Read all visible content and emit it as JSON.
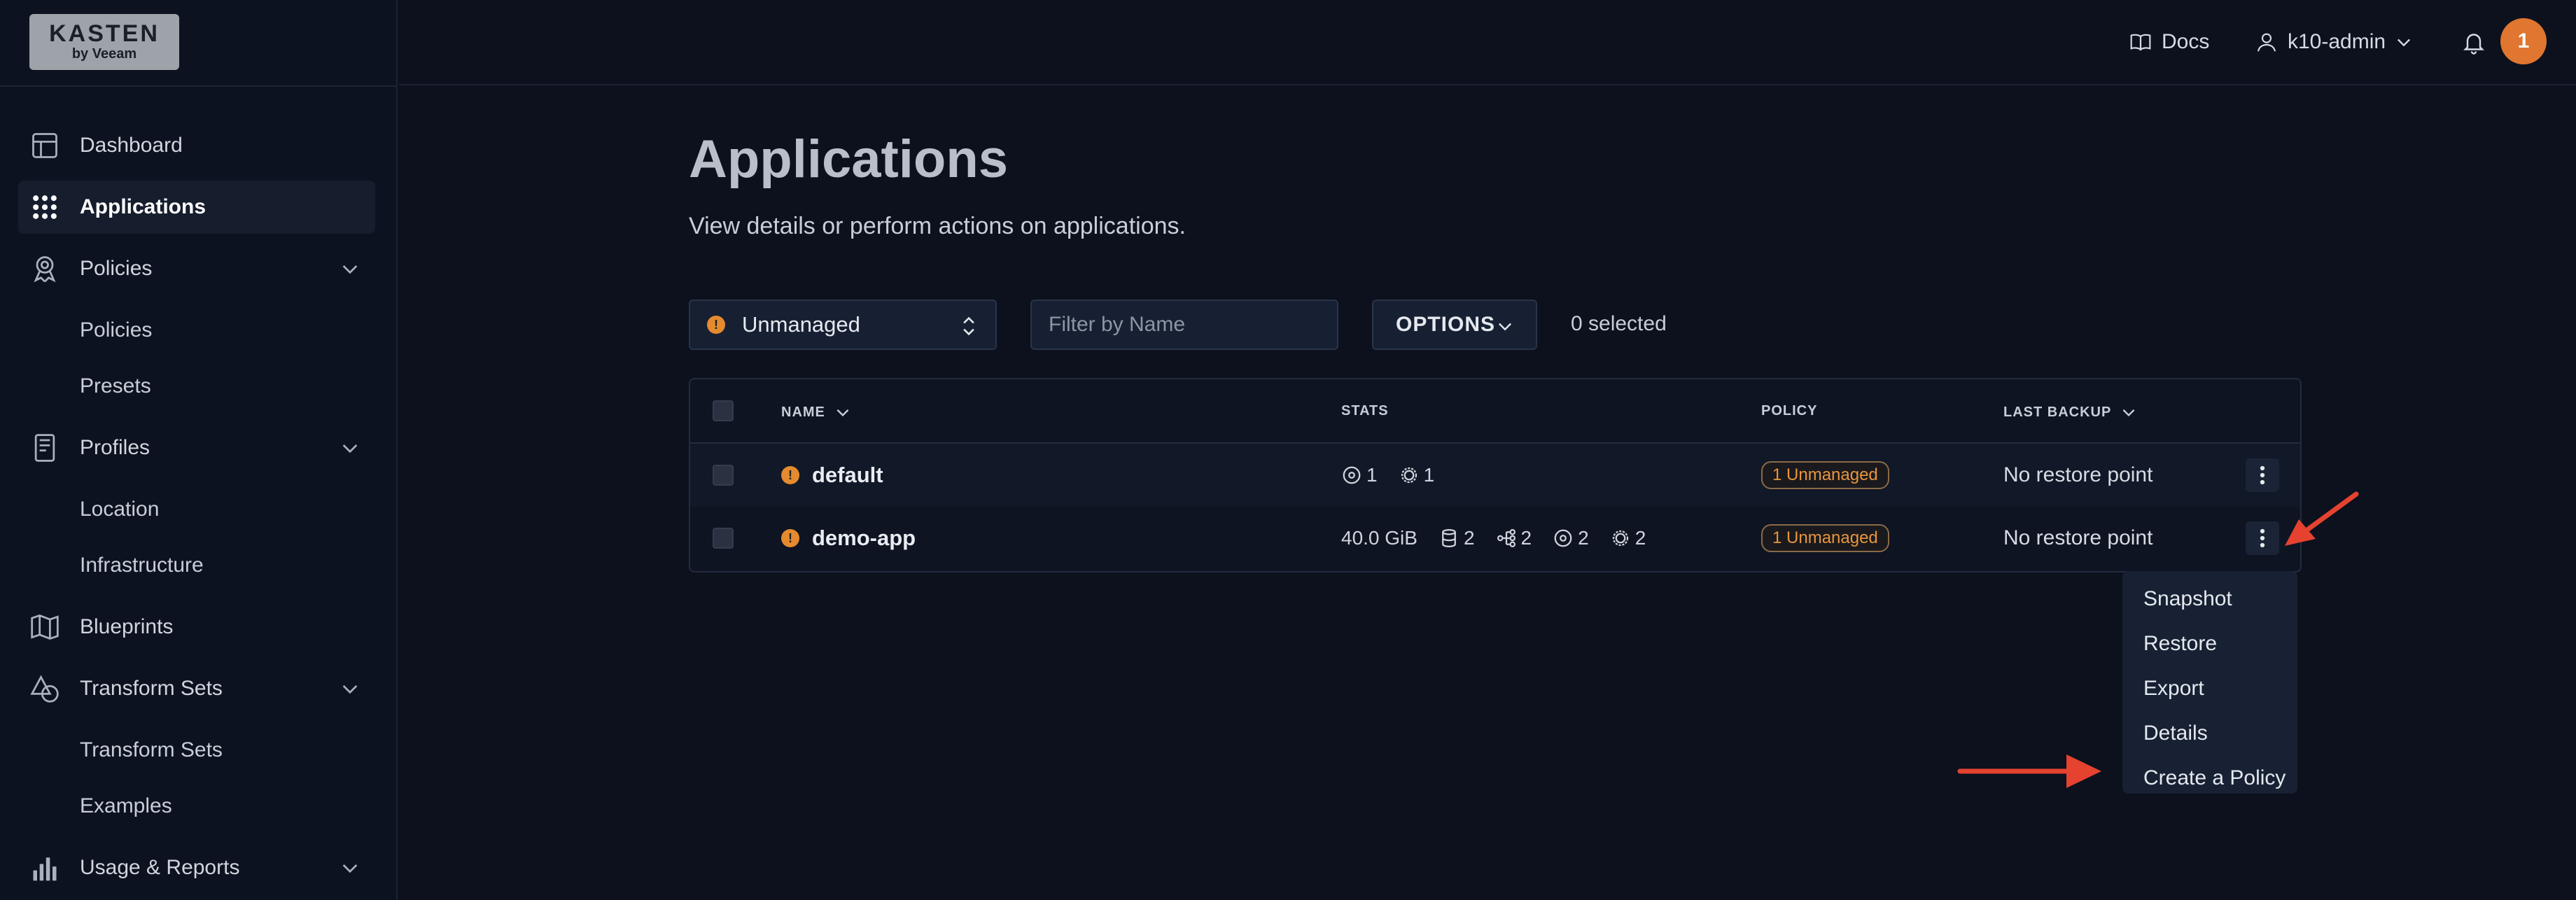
{
  "brand": {
    "line1": "KASTEN",
    "line2": "by Veeam"
  },
  "sidebar": {
    "items": [
      {
        "label": "Dashboard",
        "icon": "dashboard-icon"
      },
      {
        "label": "Applications",
        "icon": "grid-icon",
        "active": true
      },
      {
        "label": "Policies",
        "icon": "rocket-icon",
        "expandable": true
      },
      {
        "label": "Profiles",
        "icon": "document-icon",
        "expandable": true
      },
      {
        "label": "Blueprints",
        "icon": "map-icon"
      },
      {
        "label": "Transform Sets",
        "icon": "shapes-icon",
        "expandable": true
      },
      {
        "label": "Usage & Reports",
        "icon": "bar-chart-icon",
        "expandable": true
      }
    ],
    "sub": {
      "policies": [
        "Policies",
        "Presets"
      ],
      "profiles": [
        "Location",
        "Infrastructure"
      ],
      "transform_sets": [
        "Transform Sets",
        "Examples"
      ]
    }
  },
  "header": {
    "docs": "Docs",
    "user": "k10-admin",
    "notifications": "1"
  },
  "main": {
    "title": "Applications",
    "description": "View details or perform actions on applications.",
    "filter_select": "Unmanaged",
    "filter_placeholder": "Filter by Name",
    "options_label": "OPTIONS",
    "selected_count": "0 selected"
  },
  "table": {
    "columns": [
      "NAME",
      "STATS",
      "POLICY",
      "LAST BACKUP"
    ],
    "rows": [
      {
        "name": "default",
        "stats": {
          "a": "1",
          "b": "1"
        },
        "policy": "1 Unmanaged",
        "last_backup": "No restore point"
      },
      {
        "name": "demo-app",
        "stats": {
          "size": "40.0 GiB",
          "a": "2",
          "b": "2",
          "c": "2",
          "d": "2"
        },
        "policy": "1 Unmanaged",
        "last_backup": "No restore point"
      }
    ]
  },
  "menu": {
    "items": [
      "Snapshot",
      "Restore",
      "Export",
      "Details",
      "Create a Policy"
    ]
  },
  "colors": {
    "accent": "#e0762f",
    "warning": "#e58a2e",
    "arrow": "#e5422f"
  }
}
